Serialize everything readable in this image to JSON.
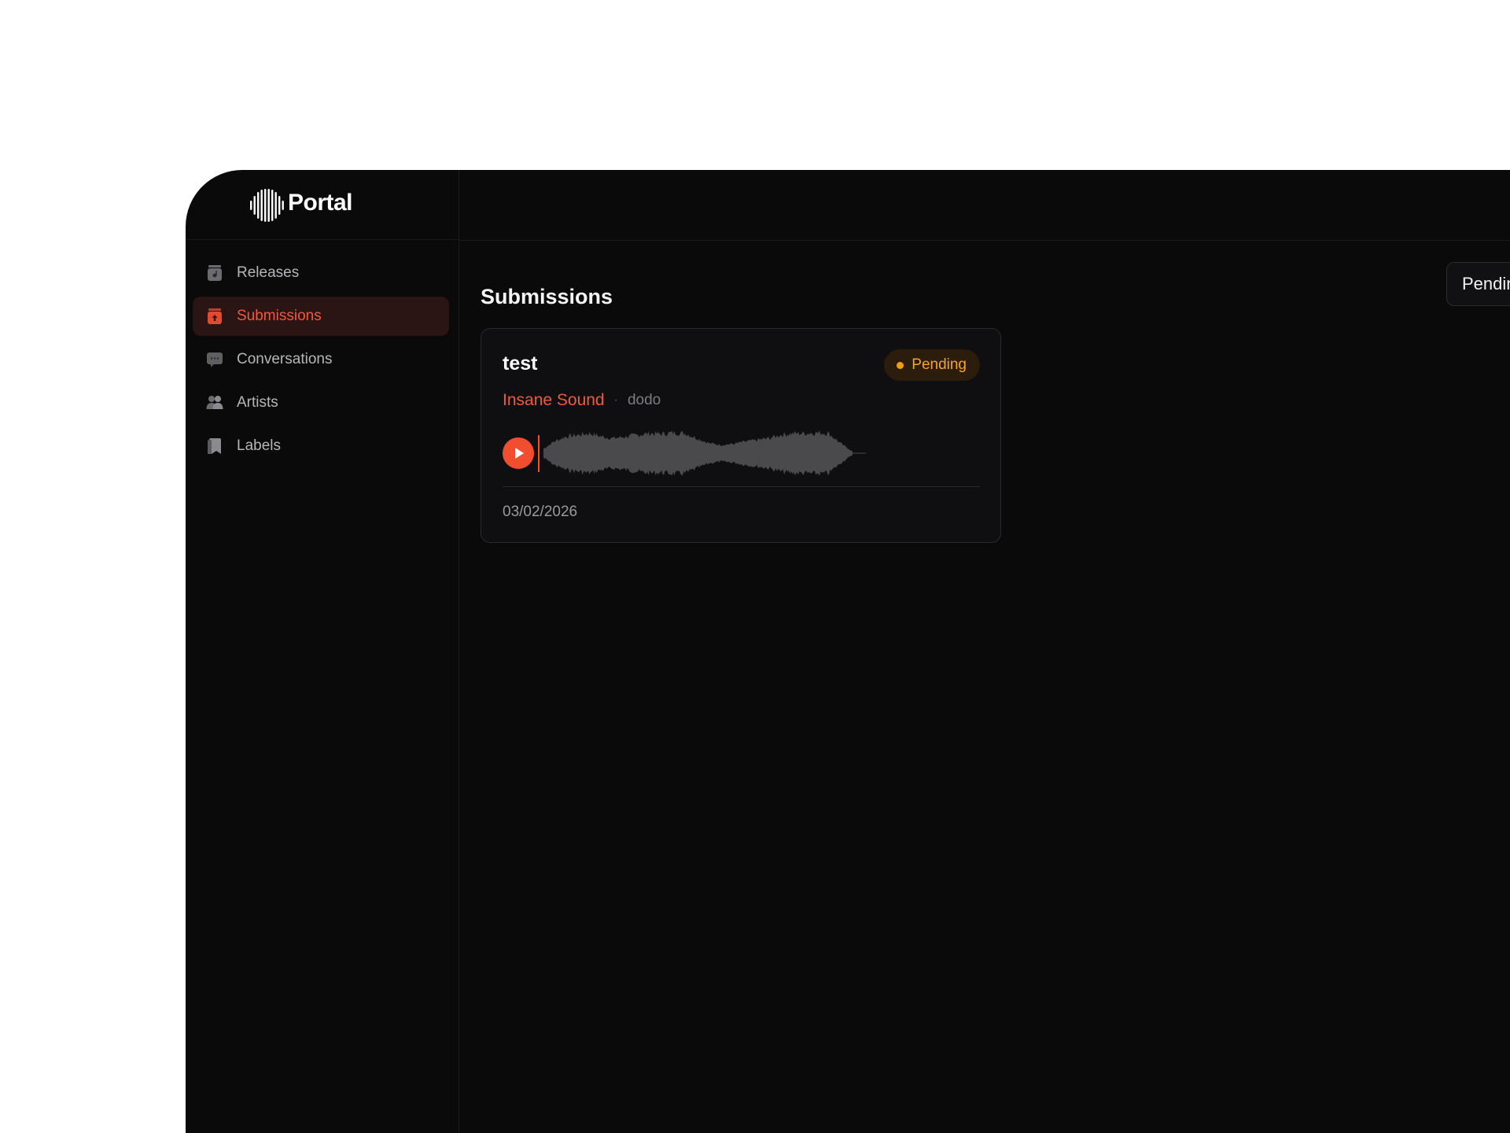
{
  "brand": {
    "name": "Portal"
  },
  "sidebar": {
    "items": [
      {
        "label": "Releases",
        "icon": "release-disc-icon",
        "active": false
      },
      {
        "label": "Submissions",
        "icon": "upload-tray-icon",
        "active": true
      },
      {
        "label": "Conversations",
        "icon": "chat-bubble-icon",
        "active": false
      },
      {
        "label": "Artists",
        "icon": "users-icon",
        "active": false
      },
      {
        "label": "Labels",
        "icon": "bookmark-icon",
        "active": false
      }
    ]
  },
  "main": {
    "title": "Submissions",
    "filter_label": "Pending"
  },
  "submissions": [
    {
      "title": "test",
      "status": "Pending",
      "label_name": "Insane Sound",
      "separator": "·",
      "artist": "dodo",
      "date": "03/02/2026",
      "playback_progress": 0
    }
  ],
  "colors": {
    "accent": "#f05a3a",
    "pending": "#f59e0b",
    "background": "#0a0a0b",
    "card": "#0f0f11"
  }
}
